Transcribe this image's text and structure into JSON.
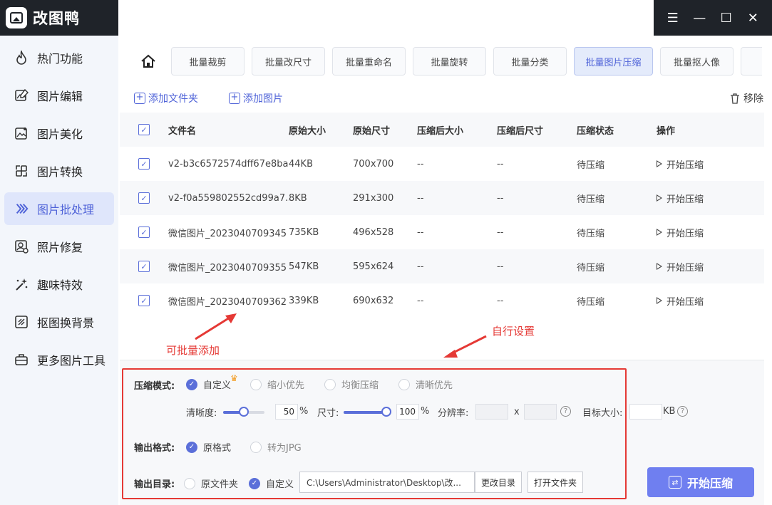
{
  "app": {
    "title": "改图鸭"
  },
  "window": {
    "menu_icon": "☰",
    "minimize_icon": "—",
    "maximize_icon": "☐",
    "close_icon": "✕"
  },
  "sidebar": {
    "items": [
      {
        "label": "热门功能",
        "icon": "flame-icon"
      },
      {
        "label": "图片编辑",
        "icon": "image-edit-icon"
      },
      {
        "label": "图片美化",
        "icon": "image-beautify-icon"
      },
      {
        "label": "图片转换",
        "icon": "convert-icon"
      },
      {
        "label": "图片批处理",
        "icon": "batch-icon",
        "active": true
      },
      {
        "label": "照片修复",
        "icon": "photo-repair-icon"
      },
      {
        "label": "趣味特效",
        "icon": "magic-wand-icon"
      },
      {
        "label": "抠图换背景",
        "icon": "cutout-icon"
      },
      {
        "label": "更多图片工具",
        "icon": "toolbox-icon"
      }
    ]
  },
  "tabs": [
    "批量裁剪",
    "批量改尺寸",
    "批量重命名",
    "批量旋转",
    "批量分类",
    "批量图片压缩",
    "批量抠人像"
  ],
  "active_tab": "批量图片压缩",
  "toolbar": {
    "add_folder": "添加文件夹",
    "add_image": "添加图片",
    "remove": "移除"
  },
  "table": {
    "headers": {
      "name": "文件名",
      "orig_size": "原始大小",
      "orig_dim": "原始尺寸",
      "comp_size": "压缩后大小",
      "comp_dim": "压缩后尺寸",
      "status": "压缩状态",
      "op": "操作"
    },
    "rows": [
      {
        "name": "v2-b3c6572574dff67e8ba...",
        "orig_size": "44KB",
        "orig_dim": "700x700",
        "comp_size": "--",
        "comp_dim": "--",
        "status": "待压缩",
        "op": "开始压缩"
      },
      {
        "name": "v2-f0a559802552cd99a7...",
        "orig_size": "8KB",
        "orig_dim": "291x300",
        "comp_size": "--",
        "comp_dim": "--",
        "status": "待压缩",
        "op": "开始压缩"
      },
      {
        "name": "微信图片_2023040709345",
        "orig_size": "735KB",
        "orig_dim": "496x528",
        "comp_size": "--",
        "comp_dim": "--",
        "status": "待压缩",
        "op": "开始压缩"
      },
      {
        "name": "微信图片_2023040709355",
        "orig_size": "547KB",
        "orig_dim": "595x624",
        "comp_size": "--",
        "comp_dim": "--",
        "status": "待压缩",
        "op": "开始压缩"
      },
      {
        "name": "微信图片_2023040709362",
        "orig_size": "339KB",
        "orig_dim": "690x632",
        "comp_size": "--",
        "comp_dim": "--",
        "status": "待压缩",
        "op": "开始压缩"
      }
    ]
  },
  "annotations": {
    "batch_add": "可批量添加",
    "custom_settings": "自行设置",
    "color": "#e53935"
  },
  "settings": {
    "mode_label": "压缩模式:",
    "mode_options": [
      "自定义",
      "缩小优先",
      "均衡压缩",
      "清晰优先"
    ],
    "clarity_label": "清晰度:",
    "clarity_value": "50",
    "size_label": "尺寸:",
    "size_value": "100",
    "percent": "%",
    "resolution_label": "分辨率:",
    "x_sep": "x",
    "target_label": "目标大小:",
    "target_unit": "KB",
    "format_label": "输出格式:",
    "format_options": [
      "原格式",
      "转为JPG"
    ],
    "dir_label": "输出目录:",
    "dir_options": [
      "原文件夹",
      "自定义"
    ],
    "dir_path": "C:\\Users\\Administrator\\Desktop\\改...",
    "change_dir": "更改目录",
    "open_folder": "打开文件夹",
    "help": "?"
  },
  "start_button": "开始压缩",
  "colors": {
    "accent": "#5b6fd9",
    "button": "#6f7ff0",
    "dark": "#1f2329"
  }
}
